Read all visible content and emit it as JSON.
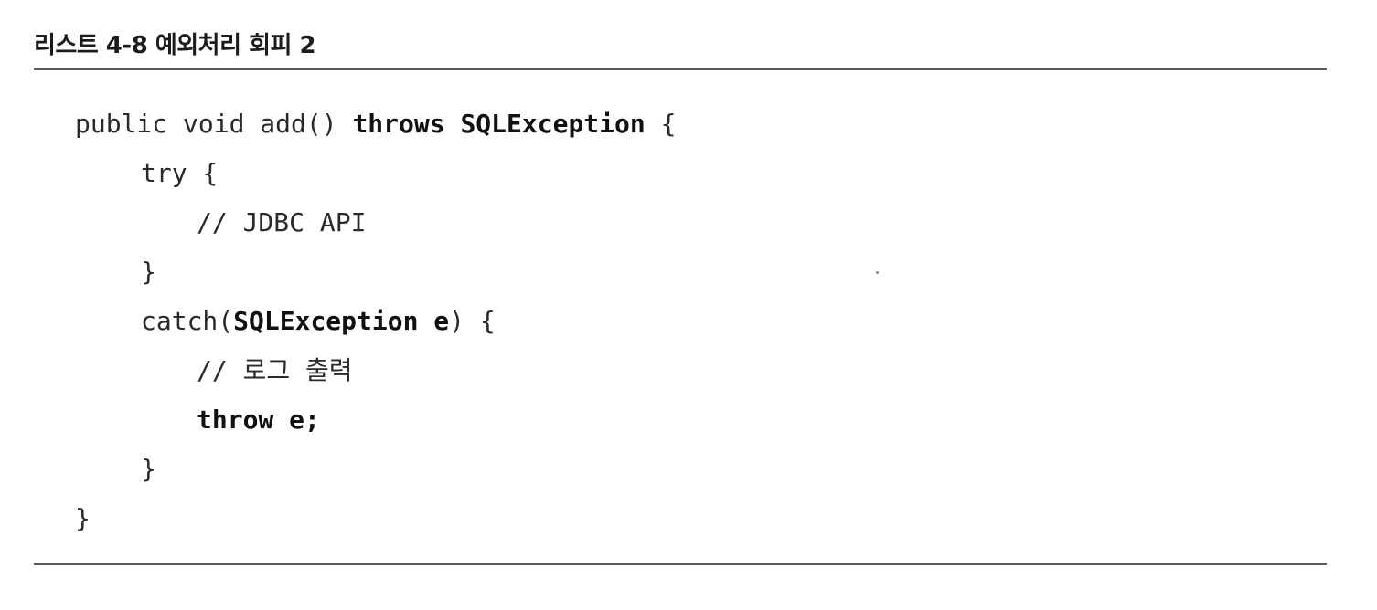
{
  "listing": {
    "title": "리스트 4-8 예외처리 회피 2"
  },
  "code": {
    "lines": [
      {
        "indent": 0,
        "tokens": [
          {
            "text": "public void add() ",
            "bold": false
          },
          {
            "text": "throws SQLException",
            "bold": true
          },
          {
            "text": " {",
            "bold": false
          }
        ]
      },
      {
        "indent": 1,
        "tokens": [
          {
            "text": "try {",
            "bold": false
          }
        ]
      },
      {
        "indent": 2,
        "tokens": [
          {
            "text": "// JDBC API",
            "bold": false
          }
        ]
      },
      {
        "indent": 1,
        "tokens": [
          {
            "text": "}",
            "bold": false
          }
        ]
      },
      {
        "indent": 1,
        "tokens": [
          {
            "text": "catch(",
            "bold": false
          },
          {
            "text": "SQLException e",
            "bold": true
          },
          {
            "text": ") {",
            "bold": false
          }
        ]
      },
      {
        "indent": 2,
        "tokens": [
          {
            "text": "// 로그 출력",
            "bold": false
          }
        ]
      },
      {
        "indent": 2,
        "tokens": [
          {
            "text": "throw e;",
            "bold": true
          }
        ]
      },
      {
        "indent": 1,
        "tokens": [
          {
            "text": "}",
            "bold": false
          }
        ]
      },
      {
        "indent": 0,
        "tokens": [
          {
            "text": "}",
            "bold": false
          }
        ]
      }
    ]
  }
}
